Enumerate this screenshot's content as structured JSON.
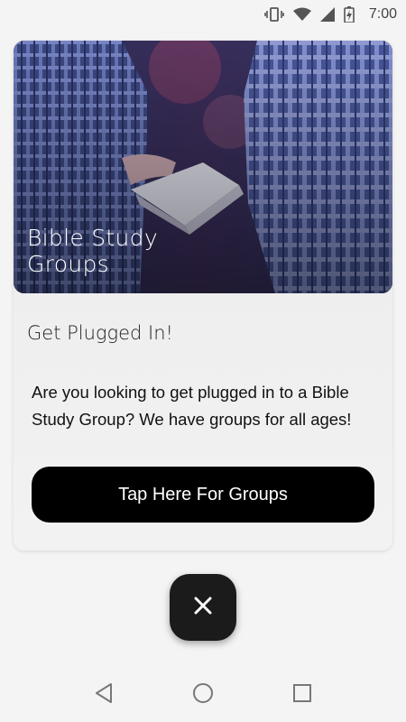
{
  "status_bar": {
    "time": "7:00",
    "icons": [
      "vibrate-icon",
      "wifi-icon",
      "signal-icon",
      "battery-icon"
    ]
  },
  "card": {
    "hero_title": "Bible Study Groups",
    "section_title": "Get Plugged In!",
    "body": "Are you looking to get plugged in to a Bible Study Group? We have groups for all ages!",
    "button_label": "Tap Here For Groups"
  },
  "fab": {
    "icon": "close-icon"
  },
  "nav_bar": {
    "icons": [
      "back-icon",
      "home-icon",
      "recents-icon"
    ]
  },
  "colors": {
    "button_bg": "#000000",
    "fab_bg": "#1b1b1b",
    "page_bg": "#f4f4f4"
  }
}
